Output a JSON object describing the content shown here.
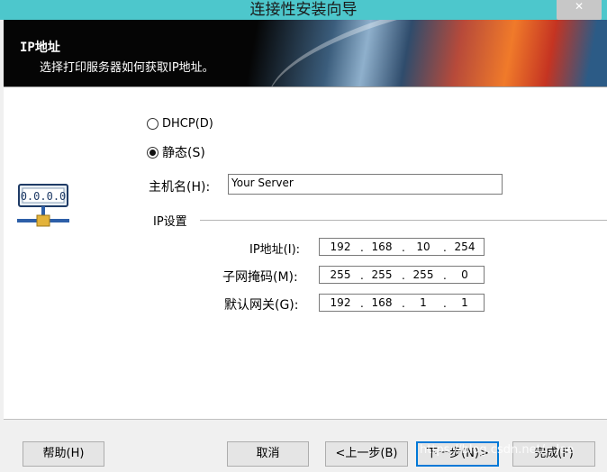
{
  "window": {
    "title": "连接性安装向导"
  },
  "header": {
    "title": "IP地址",
    "subtitle": "选择打印服务器如何获取IP地址。"
  },
  "mode": {
    "dhcp_label": "DHCP(D)",
    "static_label": "静态(S)",
    "selected": "static"
  },
  "hostname": {
    "label": "主机名(H):",
    "value": "Your Server"
  },
  "ip_settings": {
    "group_label": "IP设置",
    "ip_address": {
      "label": "IP地址(I):",
      "octets": [
        "192",
        "168",
        "10",
        "254"
      ]
    },
    "subnet_mask": {
      "label": "子网掩码(M):",
      "octets": [
        "255",
        "255",
        "255",
        "0"
      ]
    },
    "gateway": {
      "label": "默认网关(G):",
      "octets": [
        "192",
        "168",
        "1",
        "1"
      ]
    }
  },
  "buttons": {
    "help": "帮助(H)",
    "cancel": "取消",
    "back": "<上一步(B)",
    "next": "下一步(N)>",
    "finish": "完成(F)"
  },
  "watermark": "https://blog.csdn.net/...lee",
  "colors": {
    "titlebar": "#4dc7cc",
    "header_bg": "#050505",
    "focus_border": "#0078d7"
  }
}
